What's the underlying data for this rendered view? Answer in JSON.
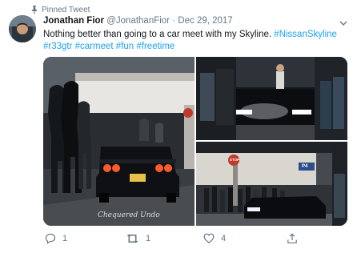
{
  "pinned_label": "Pinned Tweet",
  "author": {
    "name": "Jonathan Fior",
    "handle": "@JonathanFior",
    "date": "Dec 29, 2017",
    "separator": "·"
  },
  "tweet": {
    "text": "Nothing better than going to a car meet with my Skyline.",
    "hashtags": [
      "#NissanSkyline",
      "#r33gtr",
      "#carmeet",
      "#fun",
      "#freetime"
    ]
  },
  "media": {
    "photo1_watermark": "Chequered Undo",
    "photo3_sign_stop": "STOP",
    "photo3_sign_parking": "P4",
    "photo3_sign_level": "P4"
  },
  "actions": {
    "replies": "1",
    "retweets": "1",
    "likes": "4"
  },
  "colors": {
    "link": "#1da1f2",
    "muted": "#657786"
  },
  "icons": [
    "pin-icon",
    "chevron-down-icon",
    "reply-icon",
    "retweet-icon",
    "like-icon",
    "share-icon"
  ]
}
